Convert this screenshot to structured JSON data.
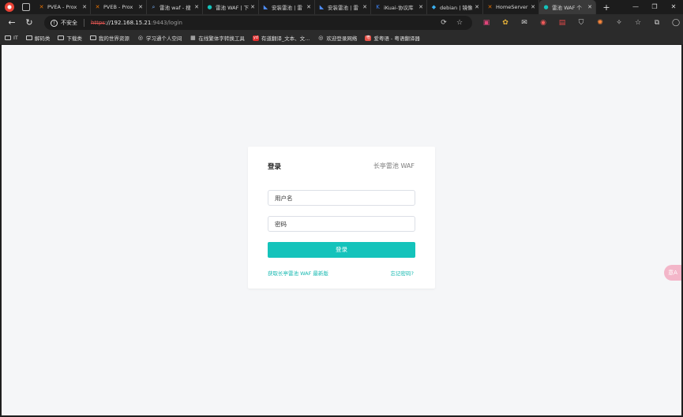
{
  "tabs": [
    {
      "label": "PVEA - Prox",
      "favicon": "proxmox-icon",
      "glyph": "✕",
      "color": "#e57000",
      "active": false
    },
    {
      "label": "PVEB - Prox",
      "favicon": "proxmox-icon",
      "glyph": "✕",
      "color": "#e57000",
      "active": false
    },
    {
      "label": "雷池 waf - 搜",
      "favicon": "search-icon",
      "glyph": "⌕",
      "color": "#7ab4ff",
      "active": false
    },
    {
      "label": "雷池 WAF | 下",
      "favicon": "safeline-icon",
      "glyph": "●",
      "color": "#14c3bb",
      "active": false
    },
    {
      "label": "安装雷池 | 雷",
      "favicon": "safeline-docs-icon",
      "glyph": "◣",
      "color": "#4e8ef7",
      "active": false
    },
    {
      "label": "安装雷池 | 雷",
      "favicon": "safeline-docs-icon",
      "glyph": "◣",
      "color": "#4e8ef7",
      "active": false
    },
    {
      "label": "iKuai-协议库",
      "favicon": "ikuai-icon",
      "glyph": "K",
      "color": "#3b82f6",
      "active": false
    },
    {
      "label": "debian | 镜像",
      "favicon": "debian-mirror-icon",
      "glyph": "◆",
      "color": "#3bb0f0",
      "active": false
    },
    {
      "label": "HomeServer",
      "favicon": "proxmox-icon",
      "glyph": "✕",
      "color": "#e57000",
      "active": false
    },
    {
      "label": "雷池 WAF 个",
      "favicon": "safeline-icon",
      "glyph": "●",
      "color": "#14c3bb",
      "active": true
    }
  ],
  "address": {
    "insecure_label": "不安全",
    "scheme": "https",
    "host": "://192.168.15.21",
    "rest": ":9443/login"
  },
  "bookmarks": [
    {
      "label": "IT",
      "icon": "folder-icon"
    },
    {
      "label": "解码类",
      "icon": "folder-icon"
    },
    {
      "label": "下载类",
      "icon": "folder-icon"
    },
    {
      "label": "我的世界资源",
      "icon": "folder-icon"
    },
    {
      "label": "学习通个人空间",
      "icon": "globe-icon"
    },
    {
      "label": "在线繁体字转换工具",
      "icon": "grid-icon"
    },
    {
      "label": "有道翻译_文本、文...",
      "icon": "youdao-icon",
      "glyph": "yd"
    },
    {
      "label": "欢迎登录网络",
      "icon": "globe-icon"
    },
    {
      "label": "爱粤语 - 粤语翻译器",
      "icon": "aiyueyu-icon",
      "glyph": "粤"
    }
  ],
  "login": {
    "title": "登录",
    "brand": "长亭雷池 WAF",
    "username_placeholder": "用户名",
    "password_placeholder": "密码",
    "submit_label": "登录",
    "get_latest_link": "获取长亭雷池 WAF 最新版",
    "forgot_link": "忘记密码?"
  },
  "float_badge": "意A",
  "colors": {
    "accent": "#14c3bb",
    "page_bg": "#f5f6f8",
    "card_bg": "#ffffff"
  }
}
